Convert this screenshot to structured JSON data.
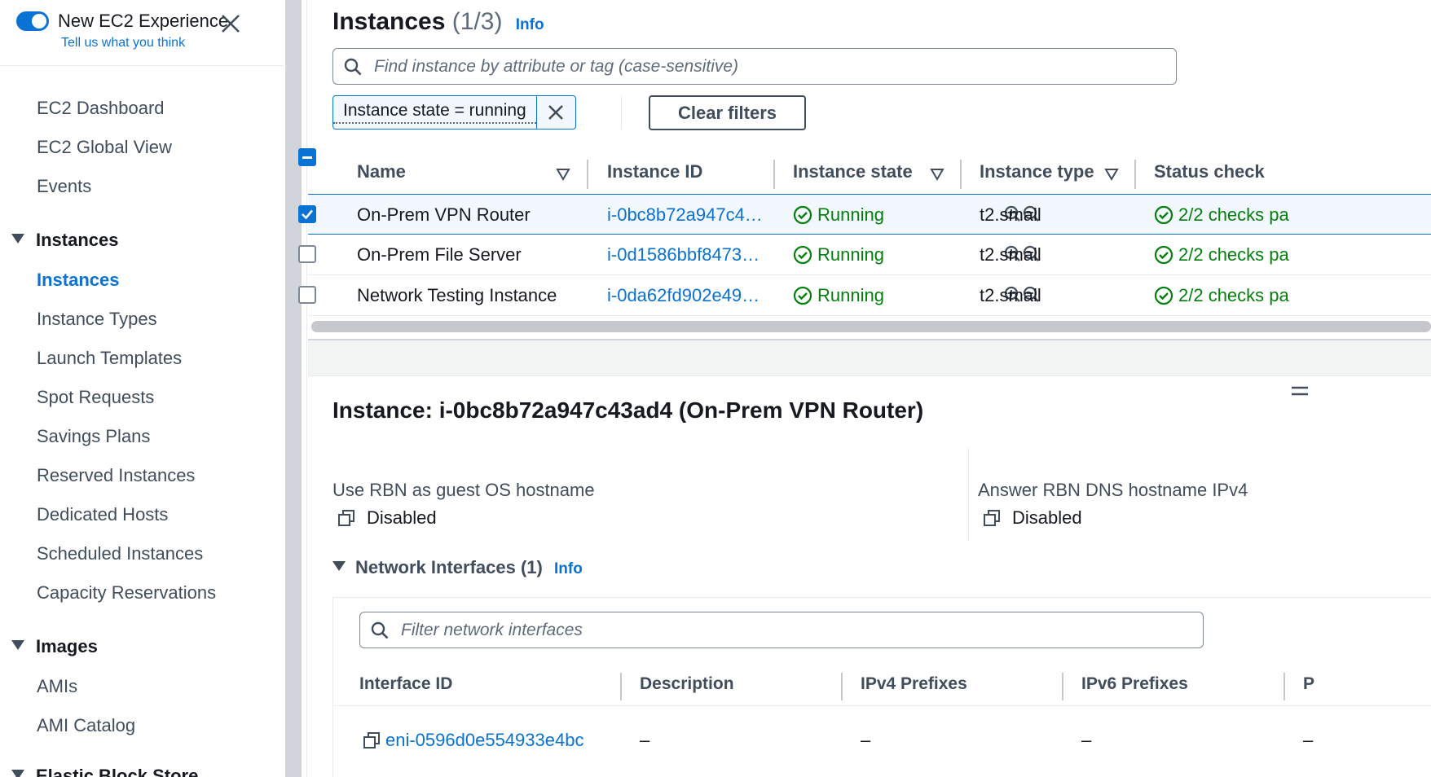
{
  "sidebar": {
    "toggle_title": "New EC2 Experience",
    "toggle_subtitle": "Tell us what you think",
    "items_top": [
      "EC2 Dashboard",
      "EC2 Global View",
      "Events"
    ],
    "section_instances": "Instances",
    "instances_items": [
      "Instances",
      "Instance Types",
      "Launch Templates",
      "Spot Requests",
      "Savings Plans",
      "Reserved Instances",
      "Dedicated Hosts",
      "Scheduled Instances",
      "Capacity Reservations"
    ],
    "section_images": "Images",
    "images_items": [
      "AMIs",
      "AMI Catalog"
    ],
    "section_ebs": "Elastic Block Store",
    "active_item": "Instances"
  },
  "header": {
    "title": "Instances",
    "count": "(1/3)",
    "info": "Info"
  },
  "search": {
    "placeholder": "Find instance by attribute or tag (case-sensitive)"
  },
  "filter": {
    "token": "Instance state = running",
    "clear_label": "Clear filters"
  },
  "table": {
    "columns": [
      "Name",
      "Instance ID",
      "Instance state",
      "Instance type",
      "Status check"
    ],
    "rows": [
      {
        "name": "On-Prem VPN Router",
        "id": "i-0bc8b72a947c4…",
        "state": "Running",
        "type": "t2.small",
        "status": "2/2 checks pa",
        "selected": true
      },
      {
        "name": "On-Prem File Server",
        "id": "i-0d1586bbf8473…",
        "state": "Running",
        "type": "t2.small",
        "status": "2/2 checks pa",
        "selected": false
      },
      {
        "name": "Network Testing Instance",
        "id": "i-0da62fd902e49…",
        "state": "Running",
        "type": "t2.small",
        "status": "2/2 checks pa",
        "selected": false
      }
    ]
  },
  "details": {
    "title": "Instance: i-0bc8b72a947c43ad4 (On-Prem VPN Router)",
    "rbn_hostname_label": "Use RBN as guest OS hostname",
    "rbn_hostname_value": "Disabled",
    "rbn_dns_label": "Answer RBN DNS hostname IPv4",
    "rbn_dns_value": "Disabled",
    "network_interfaces": {
      "title": "Network Interfaces (1)",
      "info": "Info",
      "filter_placeholder": "Filter network interfaces",
      "columns": [
        "Interface ID",
        "Description",
        "IPv4 Prefixes",
        "IPv6 Prefixes",
        "P"
      ],
      "row": {
        "id": "eni-0596d0e554933e4bc",
        "description": "–",
        "ipv4": "–",
        "ipv6": "–",
        "p": "–"
      }
    }
  },
  "colors": {
    "accent": "#0972d3",
    "success": "#037f0c",
    "text": "#16191f",
    "muted": "#414d5c"
  }
}
